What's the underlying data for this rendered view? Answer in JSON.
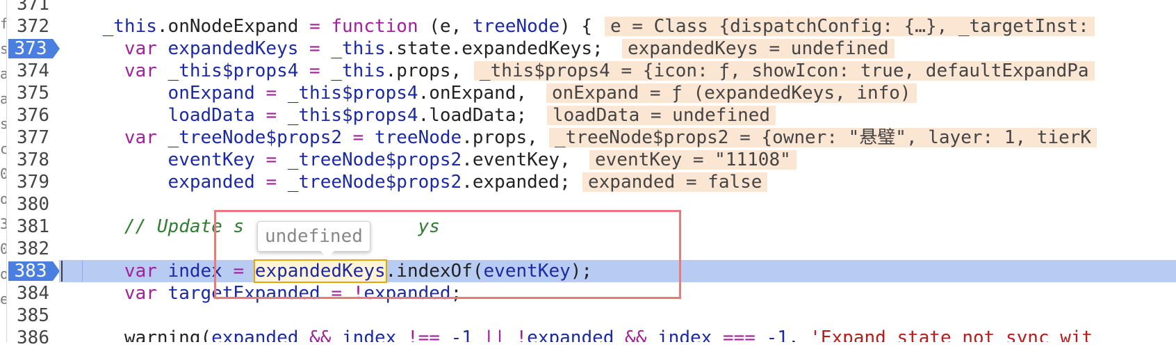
{
  "left_strip_chars": [
    "f",
    "s",
    "a",
    "a",
    "s",
    "c",
    "0",
    "o",
    "3",
    "0",
    "o",
    "e"
  ],
  "lines": [
    {
      "no": "371",
      "segments": [],
      "inline": ""
    },
    {
      "no": "372",
      "segments": [
        {
          "t": "    ",
          "c": "plain"
        },
        {
          "t": "_this",
          "c": "var"
        },
        {
          "t": ".onNodeExpand ",
          "c": "plain"
        },
        {
          "t": "=",
          "c": "op"
        },
        {
          "t": " ",
          "c": "plain"
        },
        {
          "t": "function",
          "c": "kw"
        },
        {
          "t": " (e, ",
          "c": "plain"
        },
        {
          "t": "treeNode",
          "c": "var"
        },
        {
          "t": ") {",
          "c": "plain"
        }
      ],
      "inline": "e = Class {dispatchConfig: {…}, _targetInst:"
    },
    {
      "no": "373",
      "segments": [
        {
          "t": "      ",
          "c": "plain"
        },
        {
          "t": "var",
          "c": "kw"
        },
        {
          "t": " ",
          "c": "plain"
        },
        {
          "t": "expandedKeys",
          "c": "var"
        },
        {
          "t": " ",
          "c": "plain"
        },
        {
          "t": "=",
          "c": "op"
        },
        {
          "t": " ",
          "c": "plain"
        },
        {
          "t": "_this",
          "c": "var"
        },
        {
          "t": ".state.expandedKeys;",
          "c": "plain"
        }
      ],
      "inline": "expandedKeys = undefined",
      "breakpoint": true
    },
    {
      "no": "374",
      "segments": [
        {
          "t": "      ",
          "c": "plain"
        },
        {
          "t": "var",
          "c": "kw"
        },
        {
          "t": " ",
          "c": "plain"
        },
        {
          "t": "_this$props4",
          "c": "var"
        },
        {
          "t": " ",
          "c": "plain"
        },
        {
          "t": "=",
          "c": "op"
        },
        {
          "t": " ",
          "c": "plain"
        },
        {
          "t": "_this",
          "c": "var"
        },
        {
          "t": ".props,",
          "c": "plain"
        }
      ],
      "inline": "_this$props4 = {icon: ƒ, showIcon: true, defaultExpandPa"
    },
    {
      "no": "375",
      "segments": [
        {
          "t": "          ",
          "c": "plain"
        },
        {
          "t": "onExpand",
          "c": "var"
        },
        {
          "t": " ",
          "c": "plain"
        },
        {
          "t": "=",
          "c": "op"
        },
        {
          "t": " ",
          "c": "plain"
        },
        {
          "t": "_this$props4",
          "c": "var"
        },
        {
          "t": ".onExpand,",
          "c": "plain"
        }
      ],
      "inline": "onExpand = ƒ (expandedKeys, info)"
    },
    {
      "no": "376",
      "segments": [
        {
          "t": "          ",
          "c": "plain"
        },
        {
          "t": "loadData",
          "c": "var"
        },
        {
          "t": " ",
          "c": "plain"
        },
        {
          "t": "=",
          "c": "op"
        },
        {
          "t": " ",
          "c": "plain"
        },
        {
          "t": "_this$props4",
          "c": "var"
        },
        {
          "t": ".loadData;",
          "c": "plain"
        }
      ],
      "inline": "loadData = undefined"
    },
    {
      "no": "377",
      "segments": [
        {
          "t": "      ",
          "c": "plain"
        },
        {
          "t": "var",
          "c": "kw"
        },
        {
          "t": " ",
          "c": "plain"
        },
        {
          "t": "_treeNode$props2",
          "c": "var"
        },
        {
          "t": " ",
          "c": "plain"
        },
        {
          "t": "=",
          "c": "op"
        },
        {
          "t": " ",
          "c": "plain"
        },
        {
          "t": "treeNode",
          "c": "var"
        },
        {
          "t": ".props,",
          "c": "plain"
        }
      ],
      "inline": "_treeNode$props2 = {owner: \"悬璧\", layer: 1, tierK"
    },
    {
      "no": "378",
      "segments": [
        {
          "t": "          ",
          "c": "plain"
        },
        {
          "t": "eventKey",
          "c": "var"
        },
        {
          "t": " ",
          "c": "plain"
        },
        {
          "t": "=",
          "c": "op"
        },
        {
          "t": " ",
          "c": "plain"
        },
        {
          "t": "_treeNode$props2",
          "c": "var"
        },
        {
          "t": ".eventKey,",
          "c": "plain"
        }
      ],
      "inline": "eventKey = \"11108\""
    },
    {
      "no": "379",
      "segments": [
        {
          "t": "          ",
          "c": "plain"
        },
        {
          "t": "expanded",
          "c": "var"
        },
        {
          "t": " ",
          "c": "plain"
        },
        {
          "t": "=",
          "c": "op"
        },
        {
          "t": " ",
          "c": "plain"
        },
        {
          "t": "_treeNode$props2",
          "c": "var"
        },
        {
          "t": ".expanded;",
          "c": "plain"
        }
      ],
      "inline": "expanded = false"
    },
    {
      "no": "380",
      "segments": [],
      "inline": ""
    },
    {
      "no": "381",
      "segments": [
        {
          "t": "      ",
          "c": "plain"
        },
        {
          "t": "// Update s                ys",
          "c": "cm"
        }
      ],
      "inline": ""
    },
    {
      "no": "382",
      "segments": [],
      "inline": ""
    },
    {
      "no": "383",
      "segments": [
        {
          "t": "      ",
          "c": "plain"
        },
        {
          "t": "var",
          "c": "kw"
        },
        {
          "t": " ",
          "c": "plain"
        },
        {
          "t": "index",
          "c": "var"
        },
        {
          "t": " ",
          "c": "plain"
        },
        {
          "t": "=",
          "c": "op"
        },
        {
          "t": " ",
          "c": "plain"
        },
        {
          "t": "expandedKeys",
          "c": "var hl"
        },
        {
          "t": ".indexOf(",
          "c": "plain"
        },
        {
          "t": "eventKey",
          "c": "var"
        },
        {
          "t": ");",
          "c": "plain"
        }
      ],
      "inline": "",
      "breakpoint": true,
      "exec": true
    },
    {
      "no": "384",
      "segments": [
        {
          "t": "      ",
          "c": "plain"
        },
        {
          "t": "var",
          "c": "kw"
        },
        {
          "t": " ",
          "c": "plain"
        },
        {
          "t": "targetExpanded",
          "c": "var"
        },
        {
          "t": " ",
          "c": "plain"
        },
        {
          "t": "=",
          "c": "op"
        },
        {
          "t": " !",
          "c": "op"
        },
        {
          "t": "expanded",
          "c": "var"
        },
        {
          "t": ";",
          "c": "plain"
        }
      ],
      "inline": ""
    },
    {
      "no": "385",
      "segments": [],
      "inline": ""
    },
    {
      "no": "386",
      "segments": [
        {
          "t": "      warning(",
          "c": "plain"
        },
        {
          "t": "expanded",
          "c": "var"
        },
        {
          "t": " && ",
          "c": "op"
        },
        {
          "t": "index",
          "c": "var"
        },
        {
          "t": " !== ",
          "c": "op"
        },
        {
          "t": "-1",
          "c": "num"
        },
        {
          "t": " || !",
          "c": "op"
        },
        {
          "t": "expanded",
          "c": "var"
        },
        {
          "t": " && ",
          "c": "op"
        },
        {
          "t": "index",
          "c": "var"
        },
        {
          "t": " === ",
          "c": "op"
        },
        {
          "t": "-1",
          "c": "num"
        },
        {
          "t": ", ",
          "c": "plain"
        },
        {
          "t": "'Expand state not sync wit",
          "c": "str"
        }
      ],
      "inline": ""
    }
  ],
  "tooltip": {
    "text": "undefined"
  },
  "colors": {
    "exec_line": "#b7cbf3",
    "breakpoint": "#4a7fe0",
    "inline_value_bg": "#fbe5d3",
    "annotation_box": "#e87a7a"
  }
}
